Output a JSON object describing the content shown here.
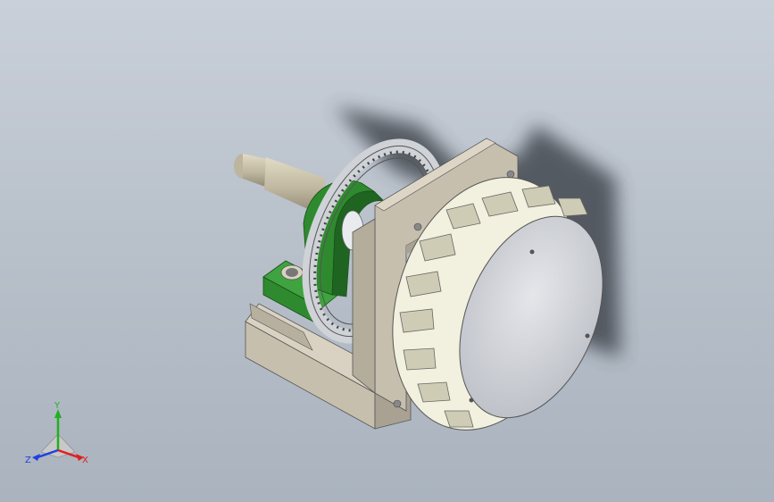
{
  "viewport": {
    "background_top": "#c9d0d9",
    "background_bottom": "#aab3be"
  },
  "model": {
    "parts": [
      "base-bracket",
      "shaft",
      "pillow-block-bearing",
      "brake-disc",
      "mount-plate",
      "tire-wheel",
      "hub-cap"
    ],
    "colors": {
      "bracket": "#c7bfae",
      "bracket_shade": "#a9a292",
      "bearing": "#2f8a2f",
      "bearing_shade": "#1f6420",
      "shaft": "#c9c1ab",
      "tire": "#f2f0de",
      "tire_shade": "#cfccb6",
      "hub": "#d6d8dd",
      "disc": "#cfd2d6",
      "shadow": "#3a3f47"
    }
  },
  "triad": {
    "x_label": "X",
    "y_label": "Y",
    "z_label": "Z",
    "x_color": "#e02020",
    "y_color": "#20b020",
    "z_color": "#2040e0"
  }
}
